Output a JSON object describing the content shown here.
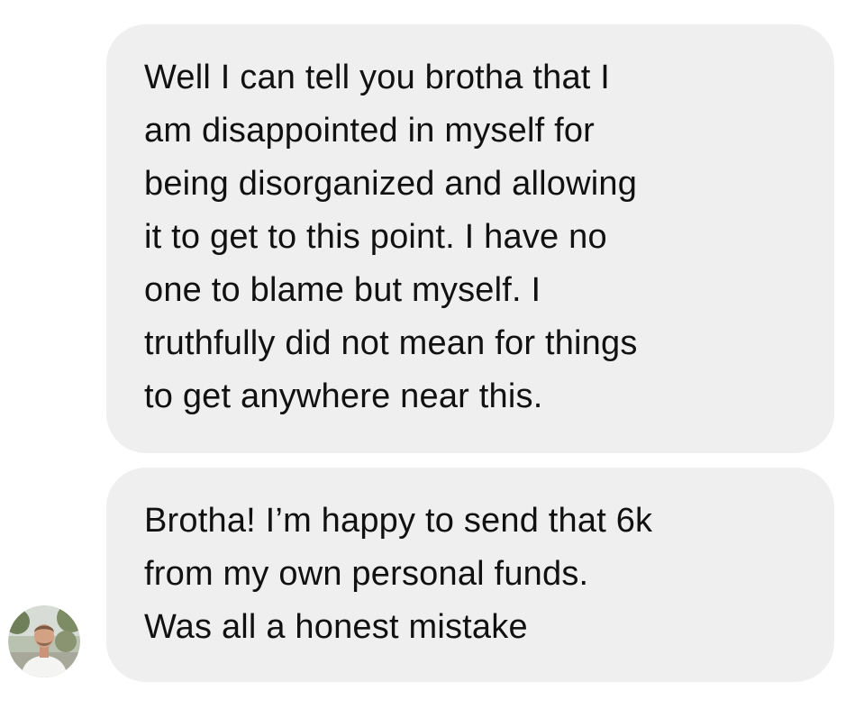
{
  "conversation": {
    "messages": [
      {
        "sender": "contact",
        "text": "Well I can tell you brotha that I\nam disappointed in myself for\nbeing disorganized and allowing\nit to get to this point. I have no\none to blame but myself. I\ntruthfully did not mean for things\nto get anywhere near this."
      },
      {
        "sender": "contact",
        "text": "Brotha! I’m happy to send that 6k\nfrom my own personal funds.\nWas all a honest mistake"
      }
    ],
    "avatar_icon": "profile-photo",
    "bubble_color": "#efefef",
    "text_color": "#111111"
  }
}
